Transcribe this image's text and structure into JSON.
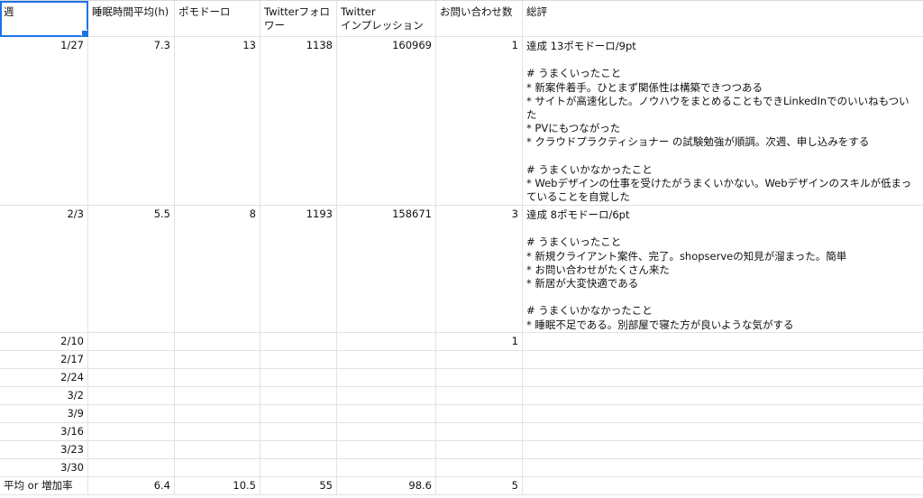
{
  "headers": [
    "週",
    "睡眠時間平均(h)",
    "ポモドーロ",
    "Twitterフォロワー",
    "Twitter\nインプレッション",
    "お問い合わせ数",
    "総評"
  ],
  "rows": [
    {
      "week": "1/27",
      "sleep": "7.3",
      "pomodoro": "13",
      "followers": "1138",
      "impressions": "160969",
      "inquiries": "1",
      "note": "達成 13ポモドーロ/9pt\n\n# うまくいったこと\n* 新案件着手。ひとまず関係性は構築できつつある\n* サイトが高速化した。ノウハウをまとめることもできLinkedInでのいいねもついた\n* PVにもつながった\n* クラウドプラクティショナー の試験勉強が順調。次週、申し込みをする\n\n# うまくいかなかったこと\n* Webデザインの仕事を受けたがうまくいかない。Webデザインのスキルが低まっていることを自覚した"
    },
    {
      "week": "2/3",
      "sleep": "5.5",
      "pomodoro": "8",
      "followers": "1193",
      "impressions": "158671",
      "inquiries": "3",
      "note": "達成 8ポモドーロ/6pt\n\n# うまくいったこと\n* 新規クライアント案件、完了。shopserveの知見が溜まった。簡単\n* お問い合わせがたくさん来た\n* 新居が大変快適である\n\n# うまくいかなかったこと\n* 睡眠不足である。別部屋で寝た方が良いような気がする"
    },
    {
      "week": "2/10",
      "sleep": "",
      "pomodoro": "",
      "followers": "",
      "impressions": "",
      "inquiries": "1",
      "note": ""
    },
    {
      "week": "2/17",
      "sleep": "",
      "pomodoro": "",
      "followers": "",
      "impressions": "",
      "inquiries": "",
      "note": ""
    },
    {
      "week": "2/24",
      "sleep": "",
      "pomodoro": "",
      "followers": "",
      "impressions": "",
      "inquiries": "",
      "note": ""
    },
    {
      "week": "3/2",
      "sleep": "",
      "pomodoro": "",
      "followers": "",
      "impressions": "",
      "inquiries": "",
      "note": ""
    },
    {
      "week": "3/9",
      "sleep": "",
      "pomodoro": "",
      "followers": "",
      "impressions": "",
      "inquiries": "",
      "note": ""
    },
    {
      "week": "3/16",
      "sleep": "",
      "pomodoro": "",
      "followers": "",
      "impressions": "",
      "inquiries": "",
      "note": ""
    },
    {
      "week": "3/23",
      "sleep": "",
      "pomodoro": "",
      "followers": "",
      "impressions": "",
      "inquiries": "",
      "note": ""
    },
    {
      "week": "3/30",
      "sleep": "",
      "pomodoro": "",
      "followers": "",
      "impressions": "",
      "inquiries": "",
      "note": ""
    }
  ],
  "summary": {
    "label": "平均 or 増加率",
    "sleep": "6.4",
    "pomodoro": "10.5",
    "followers": "55",
    "impressions": "98.6",
    "inquiries": "5",
    "note": ""
  },
  "colors": {
    "selection": "#1a73e8",
    "grid": "#e2e2e2"
  }
}
